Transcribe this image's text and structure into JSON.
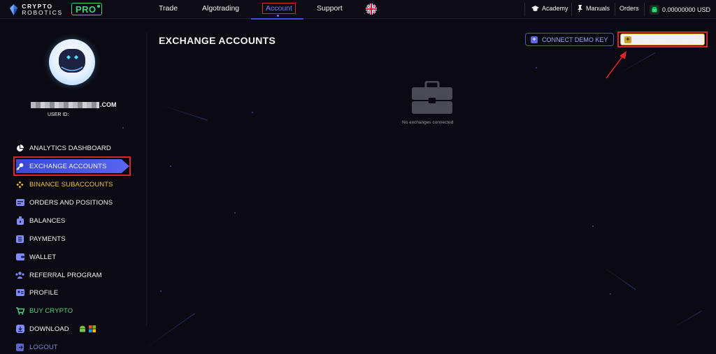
{
  "brand": {
    "line1": "CRYPTO",
    "line2": "ROBOTICS",
    "badge": "PRO"
  },
  "nav": [
    {
      "label": "Trade"
    },
    {
      "label": "Algotrading"
    },
    {
      "label": "Account"
    },
    {
      "label": "Support"
    }
  ],
  "topbar_right": {
    "academy": "Academy",
    "manuals": "Manuals",
    "orders": "Orders",
    "balance": "0.00000000 USD"
  },
  "profile": {
    "email_suffix": ".COM",
    "user_id_label": "USER ID:"
  },
  "sidebar": {
    "items": [
      {
        "label": "ANALYTICS DASHBOARD",
        "icon": "pie-chart-icon",
        "color": "#f2f2f5"
      },
      {
        "label": "EXCHANGE ACCOUNTS",
        "icon": "key-icon",
        "color": "#ffffff",
        "active": true
      },
      {
        "label": "BINANCE SUBACCOUNTS",
        "icon": "binance-icon",
        "color": "#f0c23b"
      },
      {
        "label": "ORDERS AND POSITIONS",
        "icon": "orders-icon",
        "color": "#f2f2f5"
      },
      {
        "label": "BALANCES",
        "icon": "wallet-bag-icon",
        "color": "#f2f2f5"
      },
      {
        "label": "PAYMENTS",
        "icon": "payments-icon",
        "color": "#f2f2f5"
      },
      {
        "label": "WALLET",
        "icon": "wallet-icon",
        "color": "#f2f2f5"
      },
      {
        "label": "REFERRAL PROGRAM",
        "icon": "referral-icon",
        "color": "#f2f2f5"
      },
      {
        "label": "PROFILE",
        "icon": "profile-card-icon",
        "color": "#f2f2f5"
      },
      {
        "label": "BUY CRYPTO",
        "icon": "cart-icon",
        "color": "#4cd482"
      },
      {
        "label": "DOWNLOAD",
        "icon": "download-icon",
        "color": "#f2f2f5"
      },
      {
        "label": "LOGOUT",
        "icon": "logout-icon",
        "color": "#7a86d8"
      }
    ]
  },
  "main": {
    "title": "EXCHANGE ACCOUNTS",
    "connect_demo_label": "CONNECT DEMO KEY",
    "add_exchange_label": "ADD NEW EXCHANGE",
    "empty_text": "No exchanges connected"
  },
  "colors": {
    "accent": "#4a55c8",
    "highlight": "#d8262e",
    "add_button_border": "#c9a321",
    "pro_green": "#3fd07a"
  }
}
